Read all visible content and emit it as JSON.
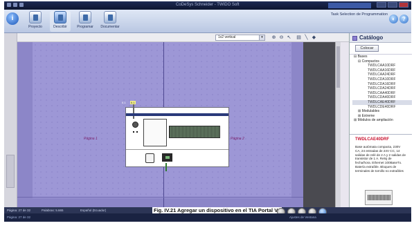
{
  "window": {
    "title": "CoDeSys Schneider - TWIDO Soft",
    "right_label": "Task Selection de Programmation"
  },
  "ribbon": {
    "tools": [
      {
        "label": "Proyecto"
      },
      {
        "label": "Describir"
      },
      {
        "label": "Programar"
      },
      {
        "label": "Documentar"
      }
    ]
  },
  "toolbar": {
    "layout_select": "1x2 vertical"
  },
  "canvas": {
    "page1": "Página 1",
    "page2": "Página 2",
    "device_tag": "0.1",
    "device_number": "0.1"
  },
  "catalog": {
    "title": "Catálogo",
    "place_button": "Colocar",
    "tree": {
      "root": "Bases",
      "compactos": "Compactos",
      "items": [
        "TWDLCAA10DRF",
        "TWDLCAA16DRF",
        "TWDLCAA24DRF",
        "TWDLCDA10DRF",
        "TWDLCDA16DRF",
        "TWDLCDA24DRF",
        "TWDLCAA40DRF",
        "TWDLCDA40DRF",
        "TWDLCAE40DRF",
        "TWDLCDE40DRF"
      ],
      "selected": "TWDLCAE40DRF",
      "modulables": "Modulables",
      "extreme": "Extreme",
      "more": "Módulos de ampliación"
    },
    "info": {
      "model": "TWDLCAE40DRF",
      "description": "Base autómata compacta, 230V CA, 24 entradas de 24V CC, 14 salidas de relé de 2 A y 2 salidas de transistor de 1 A. Reloj de fecha/hora. Ethernet 100BaseTx. Batería extraíble. Bloques de terminales de tornillo no extraíbles"
    }
  },
  "status": {
    "page": "Página: 27 de 32",
    "words": "Palabras: 5.665",
    "language": "Español (Ecuador)"
  },
  "caption": "Fig. IV.21 Agregar un dispositivo en el TIA Portal V1",
  "wordbar": {
    "left": "Página: 27 de 32",
    "right": "Ajustes de Ventana"
  },
  "colors": {
    "canvas": "#9d97d6",
    "divider": "#4d4790",
    "accent": "#c8102e"
  }
}
